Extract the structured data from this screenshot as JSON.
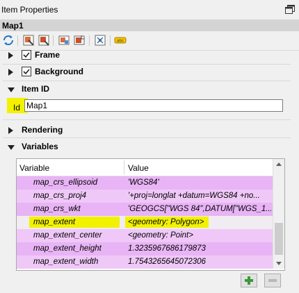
{
  "window": {
    "title": "Item Properties"
  },
  "item": {
    "name": "Map1"
  },
  "toolbar": {
    "icons": [
      "refresh-icon",
      "style-icon",
      "edit-style-icon",
      "atlas-icon",
      "export-icon",
      "grid-icon",
      "label-icon"
    ]
  },
  "sections": {
    "frame": {
      "label": "Frame",
      "checked": true
    },
    "background": {
      "label": "Background",
      "checked": true
    },
    "item_id": {
      "label": "Item ID"
    },
    "rendering": {
      "label": "Rendering"
    },
    "variables": {
      "label": "Variables"
    }
  },
  "id_field": {
    "label": "Id",
    "value": "Map1"
  },
  "variables_table": {
    "headers": {
      "variable": "Variable",
      "value": "Value"
    },
    "rows": [
      {
        "name": "map_crs_ellipsoid",
        "value": "'WGS84'"
      },
      {
        "name": "map_crs_proj4",
        "value": "'+proj=longlat +datum=WGS84 +no..."
      },
      {
        "name": "map_crs_wkt",
        "value": "'GEOGCS[\"WGS 84\",DATUM[\"WGS_1..."
      },
      {
        "name": "map_extent",
        "value": "<geometry: Polygon>"
      },
      {
        "name": "map_extent_center",
        "value": "<geometry: Point>"
      },
      {
        "name": "map_extent_height",
        "value": "1.3235967686179873"
      },
      {
        "name": "map_extent_width",
        "value": "1.7543265645072306"
      }
    ]
  },
  "colors": {
    "highlight": "#f2f200",
    "row_purple": "#e8b4f5",
    "item_bar": "#d4d4d4"
  }
}
